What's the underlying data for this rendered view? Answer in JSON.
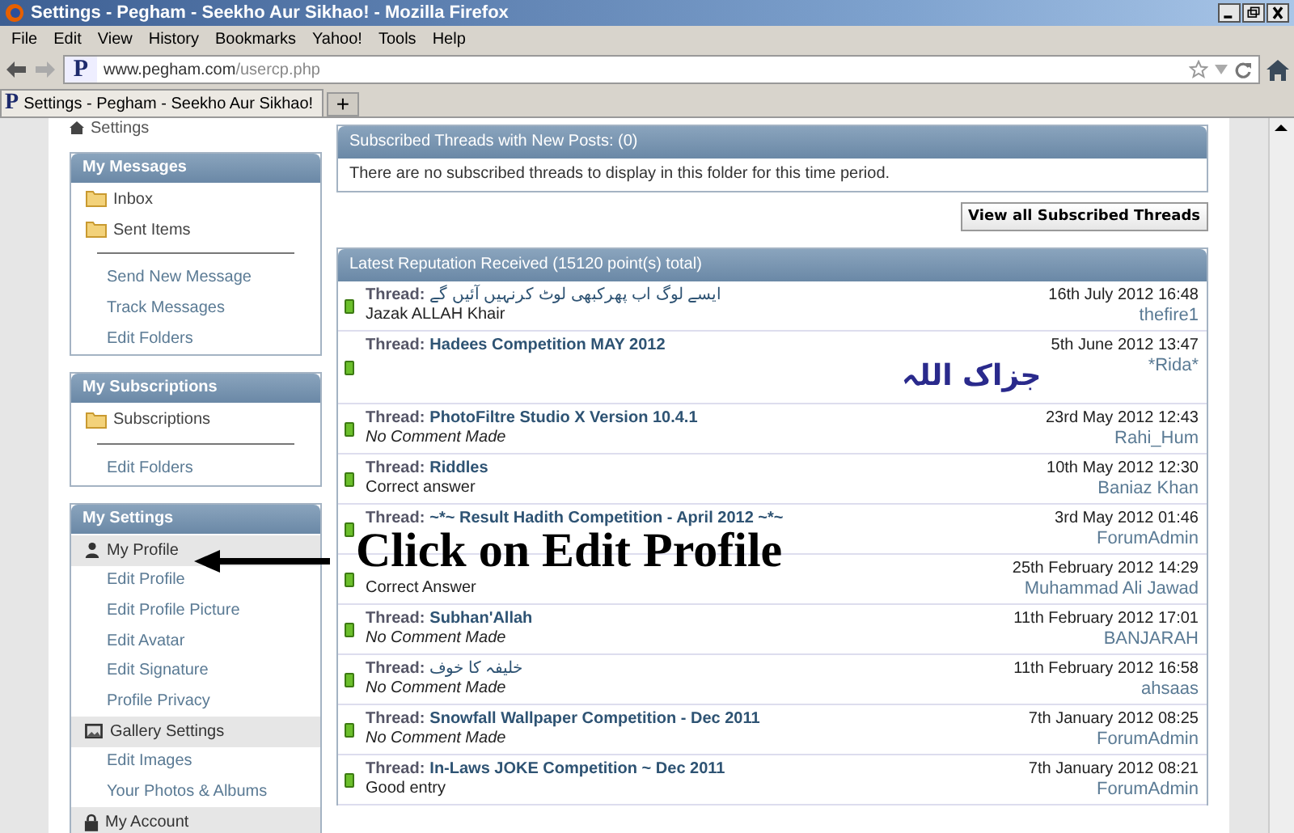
{
  "window": {
    "title": "Settings - Pegham - Seekho Aur Sikhao! - Mozilla Firefox"
  },
  "menu": [
    "File",
    "Edit",
    "View",
    "History",
    "Bookmarks",
    "Yahoo!",
    "Tools",
    "Help"
  ],
  "address": {
    "site_letter": "P",
    "host": "www.pegham.com",
    "path": "/usercp.php"
  },
  "tabs": [
    {
      "label": "Settings - Pegham - Seekho Aur Sikhao!",
      "icon_letter": "P",
      "selected": true
    }
  ],
  "new_tab": "+",
  "breadcrumb": "Settings",
  "sidebar": [
    {
      "title": "My Messages",
      "items": [
        {
          "kind": "folder",
          "label": "Inbox"
        },
        {
          "kind": "folder",
          "label": "Sent Items"
        },
        {
          "kind": "divider"
        },
        {
          "kind": "link",
          "label": "Send New Message"
        },
        {
          "kind": "link",
          "label": "Track Messages"
        },
        {
          "kind": "link",
          "label": "Edit Folders"
        }
      ]
    },
    {
      "title": "My Subscriptions",
      "items": [
        {
          "kind": "folder",
          "label": "Subscriptions"
        },
        {
          "kind": "divider"
        },
        {
          "kind": "link",
          "label": "Edit Folders"
        }
      ]
    },
    {
      "title": "My Settings",
      "items": [
        {
          "kind": "section",
          "label": "My Profile"
        },
        {
          "kind": "link",
          "label": "Edit Profile"
        },
        {
          "kind": "link",
          "label": "Edit Profile Picture"
        },
        {
          "kind": "link",
          "label": "Edit Avatar"
        },
        {
          "kind": "link",
          "label": "Edit Signature"
        },
        {
          "kind": "link",
          "label": "Profile Privacy"
        },
        {
          "kind": "section",
          "label": "Gallery Settings"
        },
        {
          "kind": "link",
          "label": "Edit Images"
        },
        {
          "kind": "link",
          "label": "Your Photos & Albums"
        },
        {
          "kind": "section",
          "label": "My Account"
        }
      ]
    }
  ],
  "subscribed": {
    "title": "Subscribed Threads with New Posts: (0)",
    "message": "There are no subscribed threads to display in this folder for this time period.",
    "button": "View all Subscribed Threads"
  },
  "reputation": {
    "title": "Latest Reputation Received (15120 point(s) total)",
    "rows": [
      {
        "thread_label": "Thread:",
        "title": {
          "text": "ایسے لوگ اب پھرکبھی لوٹ کرنہیں آئیں گے",
          "kind": "plain"
        },
        "comment": {
          "text": "Jazak ALLAH Khair",
          "kind": "plain"
        },
        "date": "16th July 2012 16:48",
        "user": "thefire1"
      },
      {
        "thread_label": "Thread:",
        "title": {
          "text": "Hadees Competition MAY 2012",
          "kind": "bold"
        },
        "comment": {
          "text": "جزاک اللہ",
          "kind": "calligraphy"
        },
        "date": "5th June 2012 13:47",
        "user": "*Rida*"
      },
      {
        "thread_label": "Thread:",
        "title": {
          "text": "PhotoFiltre Studio X Version 10.4.1",
          "kind": "bold"
        },
        "comment": {
          "text": "No Comment Made",
          "kind": "italic"
        },
        "date": "23rd May 2012 12:43",
        "user": "Rahi_Hum"
      },
      {
        "thread_label": "Thread:",
        "title": {
          "text": "Riddles",
          "kind": "bold"
        },
        "comment": {
          "text": "Correct answer",
          "kind": "plain"
        },
        "date": "10th May 2012 12:30",
        "user": "Baniaz Khan"
      },
      {
        "thread_label": "Thread:",
        "title": {
          "text": "~*~ Result Hadith Competition - April 2012 ~*~",
          "kind": "bold"
        },
        "date": "3rd May 2012 01:46",
        "user": "ForumAdmin"
      },
      {
        "comment": {
          "text": "Correct Answer",
          "kind": "plain"
        },
        "date": "25th February 2012 14:29",
        "user": "Muhammad Ali Jawad"
      },
      {
        "thread_label": "Thread:",
        "title": {
          "text": "Subhan'Allah",
          "kind": "bold"
        },
        "comment": {
          "text": "No Comment Made",
          "kind": "italic"
        },
        "date": "11th February 2012 17:01",
        "user": "BANJARAH"
      },
      {
        "thread_label": "Thread:",
        "title": {
          "text": "خلیفہ کا خوف",
          "kind": "plain"
        },
        "comment": {
          "text": "No Comment Made",
          "kind": "italic"
        },
        "date": "11th February 2012 16:58",
        "user": "ahsaas"
      },
      {
        "thread_label": "Thread:",
        "title": {
          "text": "Snowfall Wallpaper Competition - Dec 2011",
          "kind": "bold"
        },
        "comment": {
          "text": "No Comment Made",
          "kind": "italic"
        },
        "date": "7th January 2012 08:25",
        "user": "ForumAdmin"
      },
      {
        "thread_label": "Thread:",
        "title": {
          "text": "In-Laws JOKE Competition ~ Dec 2011",
          "kind": "bold"
        },
        "comment": {
          "text": "Good entry",
          "kind": "plain"
        },
        "date": "7th January 2012 08:21",
        "user": "ForumAdmin"
      }
    ]
  },
  "annotation": {
    "text": "Click on Edit Profile"
  }
}
